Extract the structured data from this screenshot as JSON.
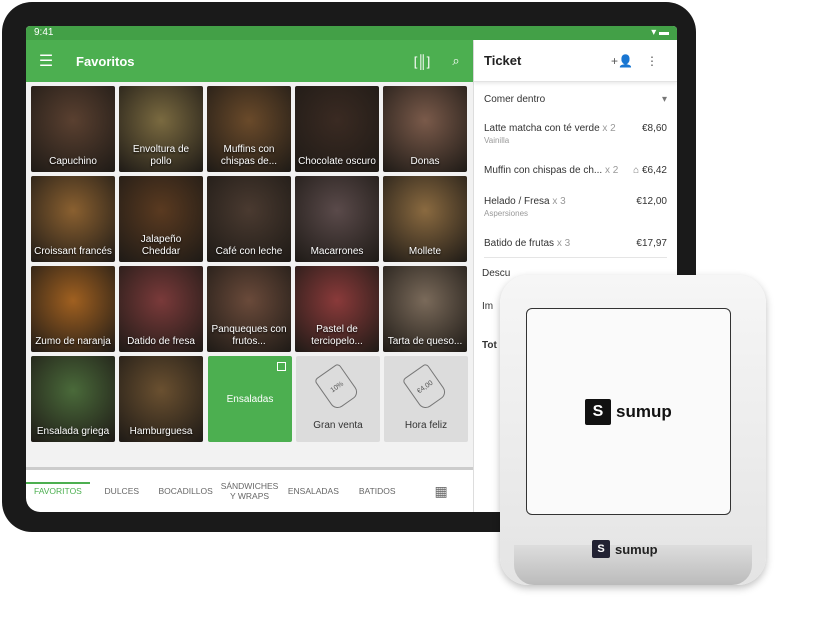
{
  "status": {
    "time": "9:41"
  },
  "appbar": {
    "title": "Favoritos",
    "menu_icon": "hamburger-icon",
    "scan_icon": "barcode-scan-icon",
    "search_icon": "search-icon"
  },
  "tiles": [
    {
      "label": "Capuchino",
      "color": "#5a4030"
    },
    {
      "label": "Envoltura de pollo",
      "color": "#7a6a40"
    },
    {
      "label": "Muffins con chispas de...",
      "color": "#6a4a2a"
    },
    {
      "label": "Chocolate oscuro",
      "color": "#3a2a22"
    },
    {
      "label": "Donas",
      "color": "#7a5a4a"
    },
    {
      "label": "Croissant francés",
      "color": "#8a6030"
    },
    {
      "label": "Jalapeño Cheddar",
      "color": "#5a3a20"
    },
    {
      "label": "Café con leche",
      "color": "#4a3a30"
    },
    {
      "label": "Macarrones",
      "color": "#5a4a4a"
    },
    {
      "label": "Mollete",
      "color": "#8a6a40"
    },
    {
      "label": "Zumo de naranja",
      "color": "#a06020"
    },
    {
      "label": "Datido de fresa",
      "color": "#7a3a3a"
    },
    {
      "label": "Panqueques con frutos...",
      "color": "#6a4a3a"
    },
    {
      "label": "Pastel de terciopelo...",
      "color": "#8a3a3a"
    },
    {
      "label": "Tarta de queso...",
      "color": "#7a6a5a"
    },
    {
      "label": "Ensalada griega",
      "color": "#4a6a3a"
    },
    {
      "label": "Hamburguesa",
      "color": "#6a5030"
    }
  ],
  "special_tiles": {
    "salads": {
      "label": "Ensaladas",
      "icon": "copy-icon"
    },
    "sale": {
      "label": "Gran venta",
      "tag": "10%"
    },
    "happy": {
      "label": "Hora feliz",
      "tag": "€4,00"
    }
  },
  "tabs": [
    {
      "label": "FAVORITOS",
      "active": true
    },
    {
      "label": "DULCES"
    },
    {
      "label": "BOCADILLOS"
    },
    {
      "label": "SÁNDWICHES Y WRAPS"
    },
    {
      "label": "ENSALADAS"
    },
    {
      "label": "BATIDOS"
    }
  ],
  "tabs_grid_icon": "grid-icon",
  "ticket": {
    "title": "Ticket",
    "add_customer_icon": "add-person-icon",
    "more_icon": "more-vert-icon",
    "dining": "Comer dentro",
    "items": [
      {
        "name": "Latte matcha con té verde",
        "qty": "x 2",
        "price": "€8,60",
        "sub": "Vainilla"
      },
      {
        "name": "Muffin con chispas de ch...",
        "qty": "x 2",
        "price": "€6,42",
        "sub": ""
      },
      {
        "name": "Helado / Fresa",
        "qty": "x 3",
        "price": "€12,00",
        "sub": "Aspersiones"
      },
      {
        "name": "Batido de frutas",
        "qty": "x 3",
        "price": "€17,97",
        "sub": ""
      }
    ],
    "discount": "Descu",
    "tax": "Im",
    "total": "Tot"
  },
  "reader": {
    "brand": "sumup"
  },
  "colors": {
    "accent": "#4caf50"
  }
}
